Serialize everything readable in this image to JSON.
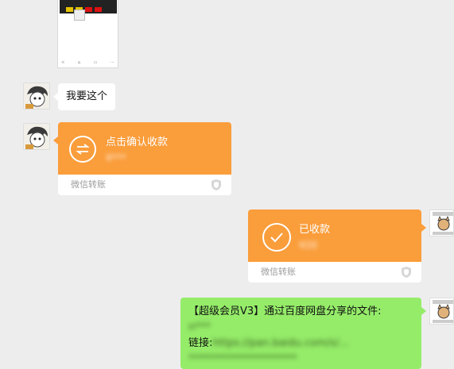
{
  "messages": {
    "text_request": "我要这个",
    "transfer_incoming": {
      "title": "点击确认收款",
      "amount": "¥***",
      "footer": "微信转账"
    },
    "transfer_received": {
      "title": "已收款",
      "amount": "¥20",
      "footer": "微信转账"
    },
    "share": {
      "line1": "【超级会员V3】通过百度网盘分享的文件:",
      "line2_blurred": "n***",
      "link_label": "链接:",
      "link_blurred": "https://pan.baidu.com/s/...",
      "line4_blurred": "*********************"
    }
  },
  "icons": {
    "transfer": "transfer-arrows-icon",
    "received": "checkmark-icon",
    "shield": "shield-icon"
  },
  "colors": {
    "background": "#ededed",
    "transfer_orange": "#fa9d3b",
    "bubble_green": "#95ec69",
    "bubble_white": "#ffffff"
  }
}
